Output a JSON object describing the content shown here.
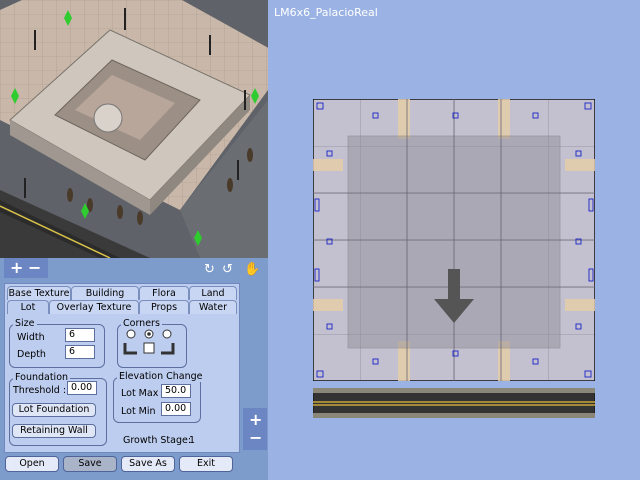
{
  "lot_name": "LM6x6_PalacioReal",
  "zoom": {
    "plus": "+",
    "minus": "−"
  },
  "rotate_icons": [
    "rotate-left-icon",
    "rotate-right-icon",
    "hand-icon"
  ],
  "tabs_row1": [
    "Base Texture",
    "Building",
    "Flora",
    "Land"
  ],
  "tabs_row2": [
    "Lot",
    "Overlay Texture",
    "Props",
    "Water"
  ],
  "active_tab": "Lot",
  "size": {
    "label": "Size",
    "width_label": "Width",
    "width": "6",
    "depth_label": "Depth",
    "depth": "6"
  },
  "corners": {
    "label": "Corners"
  },
  "foundation": {
    "label": "Foundation",
    "threshold_label": "Threshold :",
    "threshold": "0.00",
    "lot_foundation": "Lot Foundation",
    "retaining_wall": "Retaining Wall"
  },
  "elevation": {
    "label": "Elevation Change",
    "lot_max_label": "Lot Max",
    "lot_max": "50.0",
    "lot_min_label": "Lot Min",
    "lot_min": "0.00"
  },
  "growth_stage": {
    "label": "Growth Stage:",
    "value": "1"
  },
  "buttons": {
    "open": "Open",
    "save": "Save",
    "save_as": "Save As",
    "exit": "Exit"
  }
}
